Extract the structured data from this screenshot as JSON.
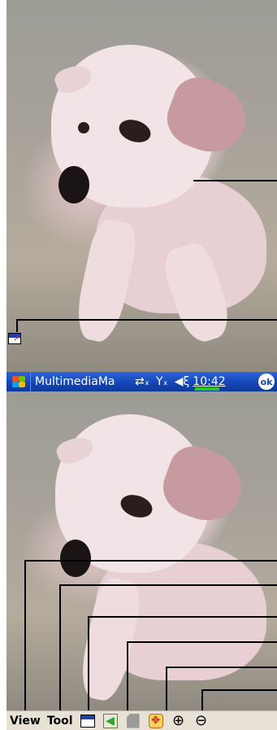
{
  "taskbar": {
    "title": "MultimediaMa",
    "clock": "10:42",
    "ok_label": "ok",
    "icons": [
      "start-flag-icon",
      "connectivity-icon",
      "signal-off-icon",
      "volume-icon"
    ]
  },
  "menubar": {
    "items": [
      "View",
      "Tool"
    ],
    "icons": [
      "window-toggle-icon",
      "back-icon",
      "disabled-icon",
      "move-icon",
      "zoom-in-icon",
      "zoom-out-icon"
    ]
  },
  "colors": {
    "taskbar": "#1447b8",
    "menubar": "#e8e2d6",
    "battery": "#28c628"
  }
}
